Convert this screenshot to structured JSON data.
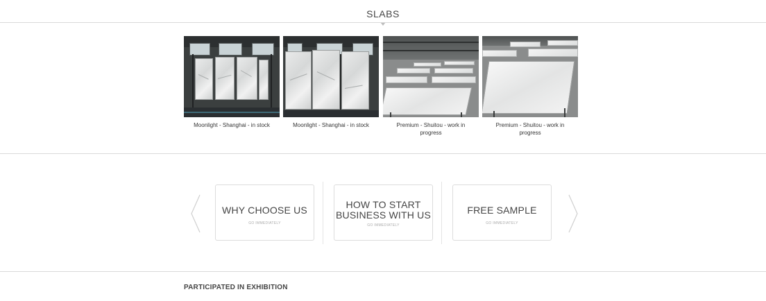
{
  "slabs": {
    "title": "SLABS",
    "items": [
      {
        "caption": "Moonlight - Shanghai - in stock"
      },
      {
        "caption": "Moonlight - Shanghai - in stock"
      },
      {
        "caption": "Premium - Shuitou - work in progress"
      },
      {
        "caption": "Premium - Shuitou - work in progress"
      }
    ]
  },
  "carousel": {
    "prev_icon": "chevron-left-icon",
    "next_icon": "chevron-right-icon",
    "cards": [
      {
        "title": "WHY CHOOSE US",
        "link": "GO IMMEDIATELY"
      },
      {
        "title": "HOW TO START BUSINESS WITH US",
        "link": "GO IMMEDIATELY"
      },
      {
        "title": "FREE SAMPLE",
        "link": "GO IMMEDIATELY"
      }
    ]
  },
  "exhibition": {
    "title": "PARTICIPATED IN EXHIBITION"
  },
  "colors": {
    "text": "#444444",
    "divider": "#d9d9d9",
    "card_border": "#dcdcdc",
    "muted": "#aaaaaa"
  }
}
